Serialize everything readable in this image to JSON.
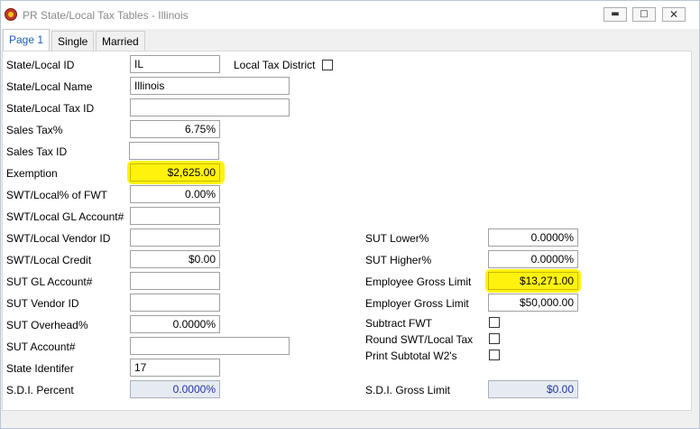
{
  "window": {
    "title": "PR State/Local Tax Tables - Illinois"
  },
  "tabs": [
    {
      "label": "Page 1"
    },
    {
      "label": "Single"
    },
    {
      "label": "Married"
    }
  ],
  "left": {
    "state_local_id": {
      "label": "State/Local ID",
      "value": "IL"
    },
    "local_tax_district": {
      "label": "Local Tax District",
      "checked": false
    },
    "state_local_name": {
      "label": "State/Local Name",
      "value": "Illinois"
    },
    "state_local_tax_id": {
      "label": "State/Local Tax ID",
      "value": ""
    },
    "sales_tax_pct": {
      "label": "Sales Tax%",
      "value": "6.75%"
    },
    "sales_tax_id": {
      "label": "Sales Tax ID",
      "value": ""
    },
    "exemption": {
      "label": "Exemption",
      "value": "$2,625.00"
    },
    "swt_local_pct_fwt": {
      "label": "SWT/Local% of FWT",
      "value": "0.00%"
    },
    "swt_local_gl_account": {
      "label": "SWT/Local GL Account#",
      "value": ""
    },
    "swt_local_vendor_id": {
      "label": "SWT/Local Vendor ID",
      "value": ""
    },
    "swt_local_credit": {
      "label": "SWT/Local Credit",
      "value": "$0.00"
    },
    "sut_gl_account": {
      "label": "SUT GL Account#",
      "value": ""
    },
    "sut_vendor_id": {
      "label": "SUT Vendor ID",
      "value": ""
    },
    "sut_overhead_pct": {
      "label": "SUT Overhead%",
      "value": "0.0000%"
    },
    "sut_account": {
      "label": "SUT Account#",
      "value": ""
    },
    "state_identifier": {
      "label": "State Identifer",
      "value": "17"
    },
    "sdi_percent": {
      "label": "S.D.I. Percent",
      "value": "0.0000%"
    }
  },
  "right": {
    "sut_lower": {
      "label": "SUT Lower%",
      "value": "0.0000%"
    },
    "sut_higher": {
      "label": "SUT Higher%",
      "value": "0.0000%"
    },
    "employee_gross_limit": {
      "label": "Employee Gross Limit",
      "value": "$13,271.00"
    },
    "employer_gross_limit": {
      "label": "Employer Gross Limit",
      "value": "$50,000.00"
    },
    "subtract_fwt": {
      "label": "Subtract FWT",
      "checked": false
    },
    "round_swt_local_tax": {
      "label": "Round SWT/Local Tax",
      "checked": false
    },
    "print_subtotal_w2s": {
      "label": "Print Subtotal W2's",
      "checked": false
    },
    "sdi_gross_limit": {
      "label": "S.D.I. Gross Limit",
      "value": "$0.00"
    }
  },
  "highlight_color": "#fff200"
}
